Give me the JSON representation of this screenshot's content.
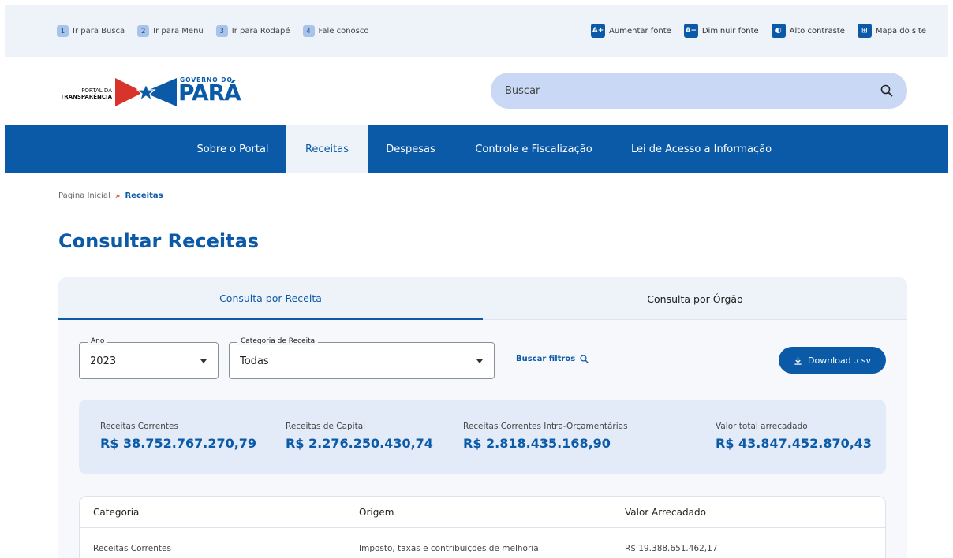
{
  "accessibility_bar": {
    "skip_links": [
      {
        "num": "1",
        "label": "Ir para Busca"
      },
      {
        "num": "2",
        "label": "Ir para Menu"
      },
      {
        "num": "3",
        "label": "Ir para Rodapé"
      },
      {
        "num": "4",
        "label": "Fale conosco"
      }
    ],
    "options": [
      {
        "badge": "A+",
        "label": "Aumentar fonte"
      },
      {
        "badge": "A−",
        "label": "Diminuir fonte"
      },
      {
        "badge": "◐",
        "label": "Alto contraste"
      },
      {
        "badge": "⊞",
        "label": "Mapa do site"
      }
    ]
  },
  "logo": {
    "portal_line1": "PORTAL DA",
    "portal_line2": "TRANSPARÊNCIA",
    "gov_line": "GOVERNO DO",
    "state": "PARÁ"
  },
  "search": {
    "placeholder": "Buscar",
    "icon": "search-icon"
  },
  "nav": {
    "items": [
      {
        "label": "Sobre o Portal"
      },
      {
        "label": "Receitas",
        "active": true
      },
      {
        "label": "Despesas"
      },
      {
        "label": "Controle e Fiscalização"
      },
      {
        "label": "Lei de Acesso a Informação"
      }
    ]
  },
  "breadcrumb": {
    "home": "Página Inicial",
    "separator": "»",
    "current": "Receitas"
  },
  "page_title": "Consultar Receitas",
  "tabs": [
    {
      "label": "Consulta por Receita",
      "active": true
    },
    {
      "label": "Consulta por Órgão"
    }
  ],
  "filters": {
    "year": {
      "label": "Ano",
      "value": "2023"
    },
    "category": {
      "label": "Categoria de Receita",
      "value": "Todas"
    },
    "search_link": "Buscar filtros",
    "download": "Download .csv"
  },
  "summary": [
    {
      "label": "Receitas Correntes",
      "value": "R$ 38.752.767.270,79"
    },
    {
      "label": "Receitas de Capital",
      "value": "R$ 2.276.250.430,74"
    },
    {
      "label": "Receitas Correntes Intra-Orçamentárias",
      "value": "R$ 2.818.435.168,90"
    },
    {
      "label": "Valor total arrecadado",
      "value": "R$ 43.847.452.870,43"
    }
  ],
  "table": {
    "headers": [
      "Categoria",
      "Origem",
      "Valor Arrecadado"
    ],
    "rows": [
      [
        "Receitas Correntes",
        "Imposto, taxas e contribuições de melhoria",
        "R$ 19.388.651.462,17"
      ]
    ]
  },
  "colors": {
    "primary": "#0b5aa8",
    "nav_bg": "#0b5aa8",
    "accent_red": "#d9342b",
    "summary_bg": "#e2ebf7"
  }
}
